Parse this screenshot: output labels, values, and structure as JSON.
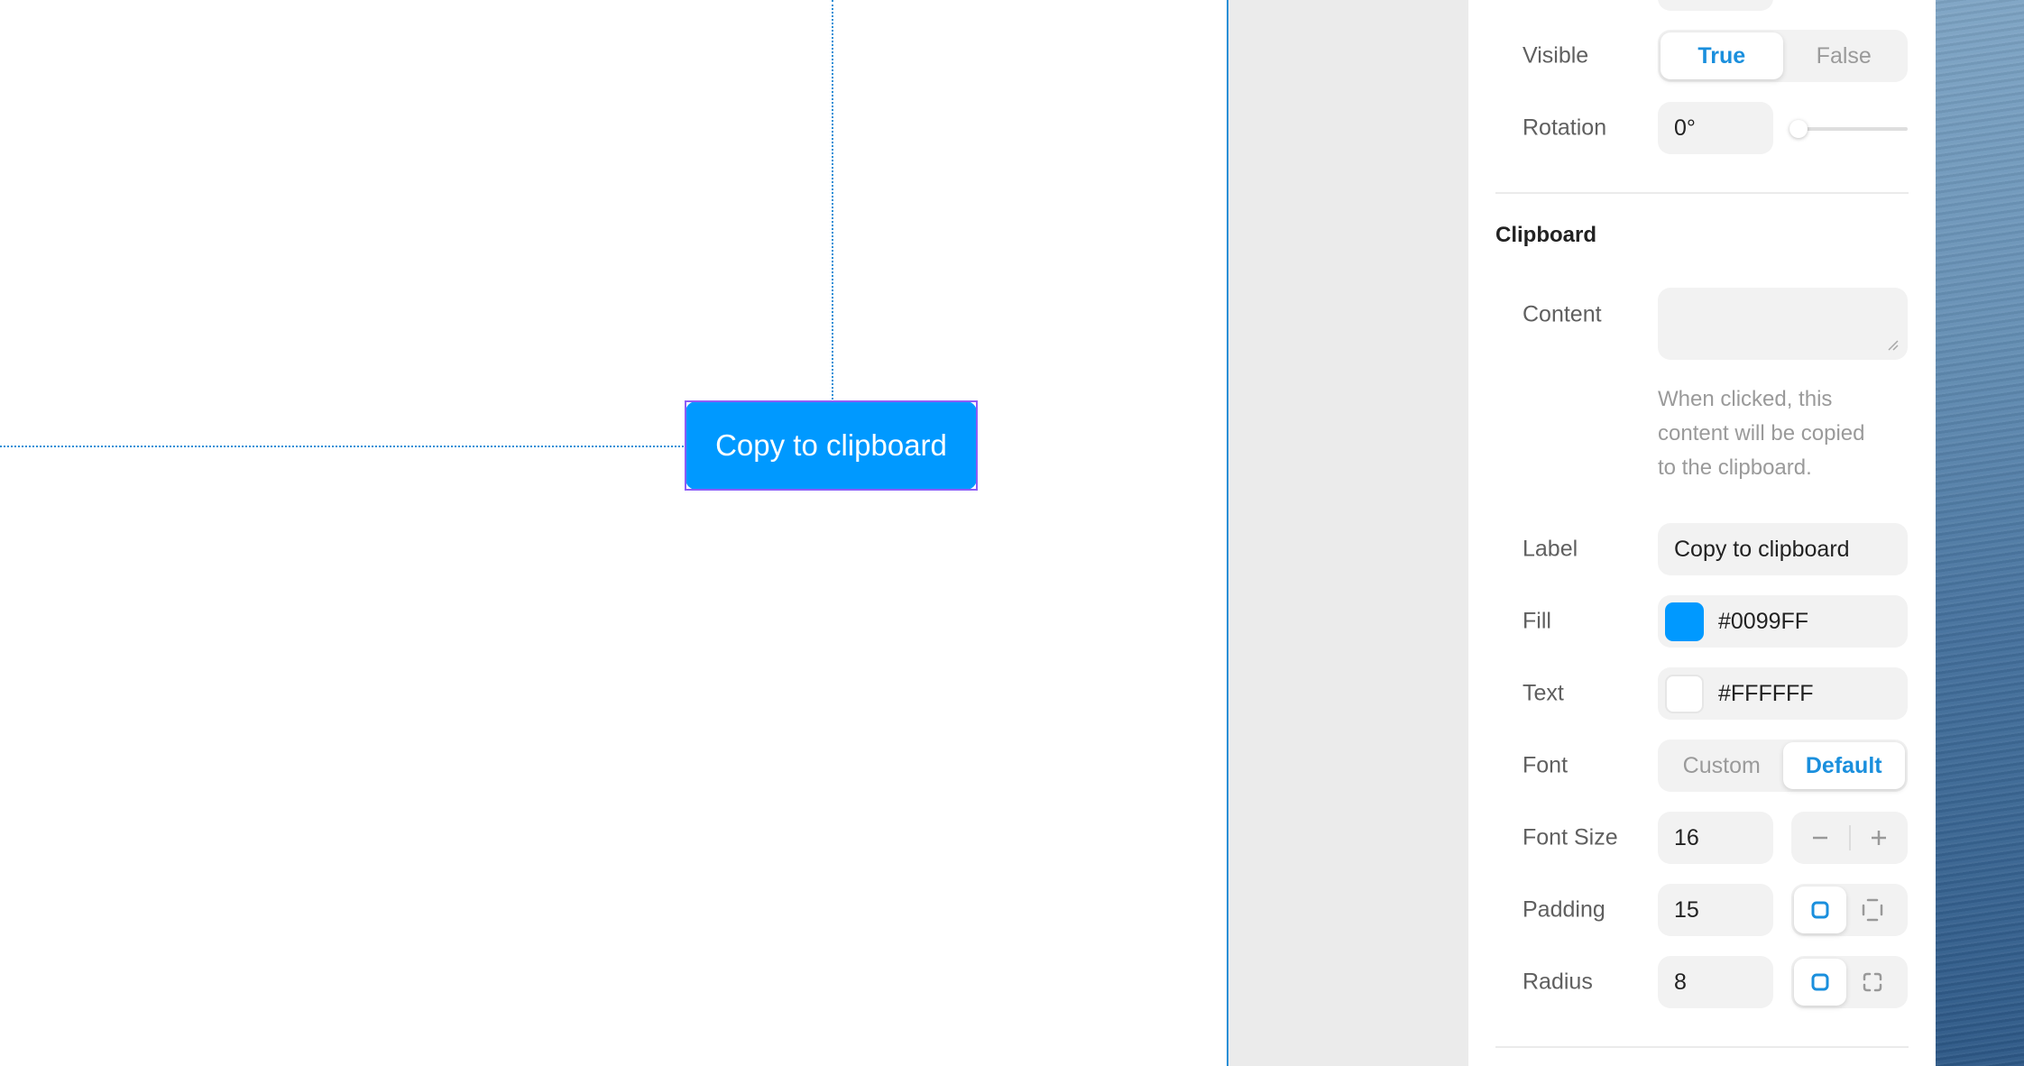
{
  "canvas": {
    "button_label": "Copy to clipboard",
    "button_fill": "#0099FF",
    "button_text_color": "#FFFFFF",
    "selection_color": "#8D5CF6",
    "guide_color": "#2A8FD6"
  },
  "panel": {
    "visible": {
      "label": "Visible",
      "options": [
        "True",
        "False"
      ],
      "selected": "True"
    },
    "rotation": {
      "label": "Rotation",
      "value": "0°",
      "slider_fraction": 0
    },
    "clipboard_section": {
      "title": "Clipboard",
      "content": {
        "label": "Content",
        "value": "",
        "help": [
          "When clicked, this",
          "content will be copied",
          "to the clipboard."
        ]
      },
      "label_field": {
        "label": "Label",
        "value": "Copy to clipboard"
      },
      "fill": {
        "label": "Fill",
        "value": "#0099FF",
        "swatch": "#0099FF"
      },
      "text": {
        "label": "Text",
        "value": "#FFFFFF",
        "swatch": "#FFFFFF"
      },
      "font": {
        "label": "Font",
        "options": [
          "Custom",
          "Default"
        ],
        "selected": "Default"
      },
      "font_size": {
        "label": "Font Size",
        "value": "16",
        "decrement_icon": "minus-icon",
        "increment_icon": "plus-icon"
      },
      "padding": {
        "label": "Padding",
        "value": "15",
        "modes": [
          "uniform-icon",
          "per-side-icon"
        ],
        "selected": "uniform"
      },
      "radius": {
        "label": "Radius",
        "value": "8",
        "modes": [
          "uniform-icon",
          "per-corner-icon"
        ],
        "selected": "uniform"
      }
    }
  },
  "accent": "#1A8FDD"
}
